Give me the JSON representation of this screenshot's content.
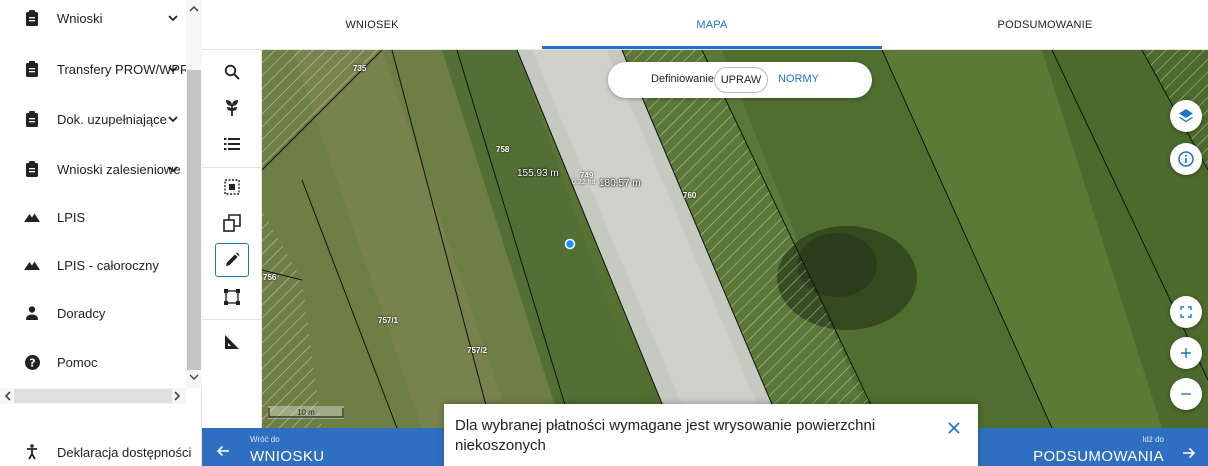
{
  "sidebar": {
    "items": [
      {
        "label": "Wnioski",
        "icon": "clipboard-icon",
        "expandable": true
      },
      {
        "label": "Transfery PROW/WPR",
        "icon": "clipboard-icon",
        "expandable": true
      },
      {
        "label": "Dok. uzupełniające",
        "icon": "clipboard-icon",
        "expandable": true
      },
      {
        "label": "Wnioski zalesieniowe",
        "icon": "clipboard-icon",
        "expandable": true
      },
      {
        "label": "LPIS",
        "icon": "mountain-icon",
        "expandable": false
      },
      {
        "label": "LPIS - całoroczny",
        "icon": "mountain-icon",
        "expandable": false
      },
      {
        "label": "Doradcy",
        "icon": "person-icon",
        "expandable": false
      },
      {
        "label": "Pomoc",
        "icon": "help-icon",
        "expandable": false
      }
    ],
    "accessibility_label": "Deklaracja dostępności"
  },
  "tabs": [
    {
      "label": "WNIOSEK",
      "active": false
    },
    {
      "label": "MAPA",
      "active": true
    },
    {
      "label": "PODSUMOWANIE",
      "active": false
    }
  ],
  "toolbar": {
    "tools": [
      "search-icon",
      "plant-icon",
      "list-icon",
      "select-area-icon",
      "copy-shape-icon",
      "pencil-icon",
      "bounding-box-icon",
      "ruler-icon"
    ],
    "active_tool": "pencil-icon"
  },
  "map": {
    "parcels": [
      "735",
      "758",
      "749",
      "760",
      "756",
      "757/1",
      "757/2"
    ],
    "measure_left": "155.93 m",
    "measure_right": "180.57 m",
    "area": "0.22 ha",
    "scale_label": "10 m",
    "definition": {
      "label": "Definiowanie",
      "option_upraw": "UPRAW",
      "option_normy": "NORMY",
      "selected": "UPRAW"
    }
  },
  "nav": {
    "back_small": "Wróć do",
    "back_big": "WNIOSKU",
    "next_small": "Idź do",
    "next_big": "PODSUMOWANIA"
  },
  "toast": {
    "message": "Dla wybranej płatności wymagane jest wrysowanie powierzchni niekoszonych"
  },
  "colors": {
    "accent": "#1e74c7",
    "bottom_bar": "#2f6fc1"
  }
}
